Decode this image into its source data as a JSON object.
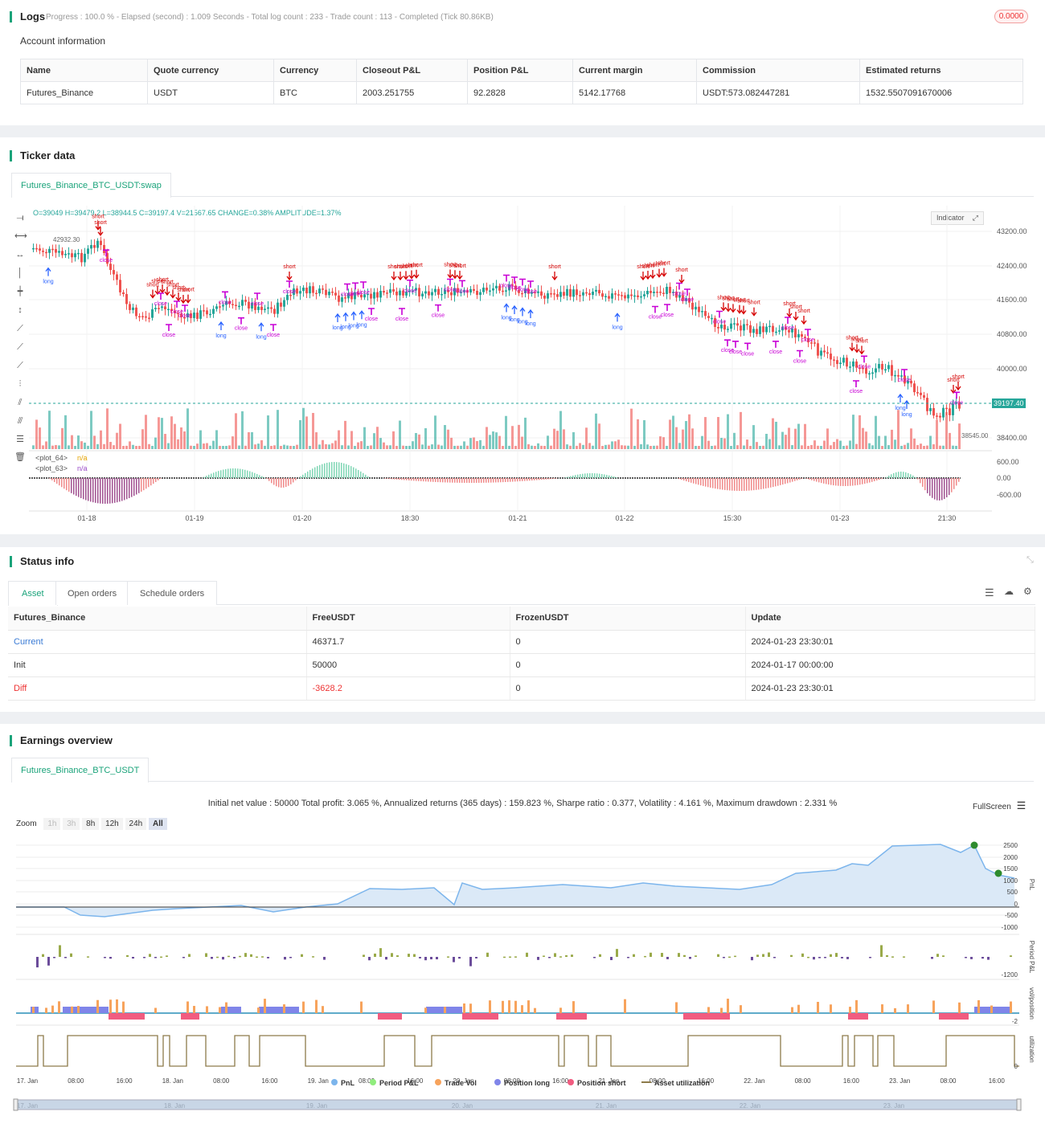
{
  "logs": {
    "title": "Logs",
    "progress_text": "Progress : 100.0 % - Elapsed (second) : 1.009  Seconds - Total log count : 233 - Trade count : 113 - Completed (Tick 80.86KB)",
    "badge": "0.0000"
  },
  "account": {
    "title": "Account information",
    "headers": [
      "Name",
      "Quote currency",
      "Currency",
      "Closeout P&L",
      "Position P&L",
      "Current margin",
      "Commission",
      "Estimated returns"
    ],
    "row": [
      "Futures_Binance",
      "USDT",
      "BTC",
      "2003.251755",
      "92.2828",
      "5142.17768",
      "USDT:573.082447281",
      "1532.5507091670006"
    ]
  },
  "ticker": {
    "title": "Ticker data",
    "tab": "Futures_Binance_BTC_USDT:swap",
    "ohlc": "O=39049 H=39479.2 L=38944.5 C=39197.4 V=21567.65 CHANGE=0.38% AMPLITUDE=1.37%",
    "indicator_btn": "Indicator",
    "price_label": "39197.40",
    "high_label": "42932.30",
    "low_label": "38545.00",
    "y_ticks": [
      "43200.00",
      "42400.00",
      "41600.00",
      "40800.00",
      "40000.00",
      "38400.00"
    ],
    "osc_ticks": [
      "600.00",
      "0.00",
      "-600.00"
    ],
    "plot64": "<plot_64>",
    "plot63": "<plot_63>",
    "na": "n/a",
    "x_ticks": [
      "01-18",
      "01-19",
      "01-20",
      "18:30",
      "01-21",
      "01-22",
      "15:30",
      "01-23",
      "21:30"
    ]
  },
  "status": {
    "title": "Status info",
    "tabs": [
      "Asset",
      "Open orders",
      "Schedule orders"
    ],
    "headers": [
      "Futures_Binance",
      "FreeUSDT",
      "FrozenUSDT",
      "Update"
    ],
    "rows": [
      [
        "Current",
        "46371.7",
        "0",
        "2024-01-23 23:30:01"
      ],
      [
        "Init",
        "50000",
        "0",
        "2024-01-17 00:00:00"
      ],
      [
        "Diff",
        "-3628.2",
        "0",
        "2024-01-23 23:30:01"
      ]
    ]
  },
  "earnings": {
    "title": "Earnings overview",
    "tab": "Futures_Binance_BTC_USDT",
    "summary": "Initial net value : 50000 Total profit: 3.065 %, Annualized returns (365 days) : 159.823 %, Sharpe ratio : 0.377, Volatility : 4.161 %, Maximum drawdown : 2.331 %",
    "fullscreen": "FullScreen",
    "zoom_label": "Zoom",
    "zoom": [
      "1h",
      "3h",
      "8h",
      "12h",
      "24h",
      "All"
    ],
    "pnl_ticks": [
      "2500",
      "2000",
      "1500",
      "1000",
      "500",
      "0",
      "-500",
      "-1000"
    ],
    "period_ticks": [
      "-1200"
    ],
    "vol_ticks": [
      "-2"
    ],
    "util_ticks": [
      "0"
    ],
    "axis_titles": [
      "PnL",
      "Period P&L",
      "vol/position",
      "utilization"
    ],
    "x_ticks": [
      "17. Jan",
      "08:00",
      "16:00",
      "18. Jan",
      "08:00",
      "16:00",
      "19. Jan",
      "08:00",
      "16:00",
      "20. Jan",
      "08:00",
      "16:00",
      "21. Jan",
      "08:00",
      "16:00",
      "22. Jan",
      "08:00",
      "16:00",
      "23. Jan",
      "08:00",
      "16:00"
    ],
    "nav_ticks": [
      "17. Jan",
      "18. Jan",
      "19. Jan",
      "20. Jan",
      "21. Jan",
      "22. Jan",
      "23. Jan"
    ],
    "legend": [
      {
        "label": "PnL",
        "color": "#7cb5ec"
      },
      {
        "label": "Period P&L",
        "color": "#90ed7d"
      },
      {
        "label": "Trade Vol",
        "color": "#f7a35c"
      },
      {
        "label": "Position long",
        "color": "#8085e9"
      },
      {
        "label": "Position short",
        "color": "#f15c80"
      },
      {
        "label": "Asset utilization",
        "color": "#8d7b4a"
      }
    ]
  },
  "colors": {
    "accent": "#1aa37a",
    "up": "#26a69a",
    "down": "#ef5350",
    "trade_long": "#2962ff",
    "trade_short": "#d50000",
    "close": "#c800d5"
  }
}
